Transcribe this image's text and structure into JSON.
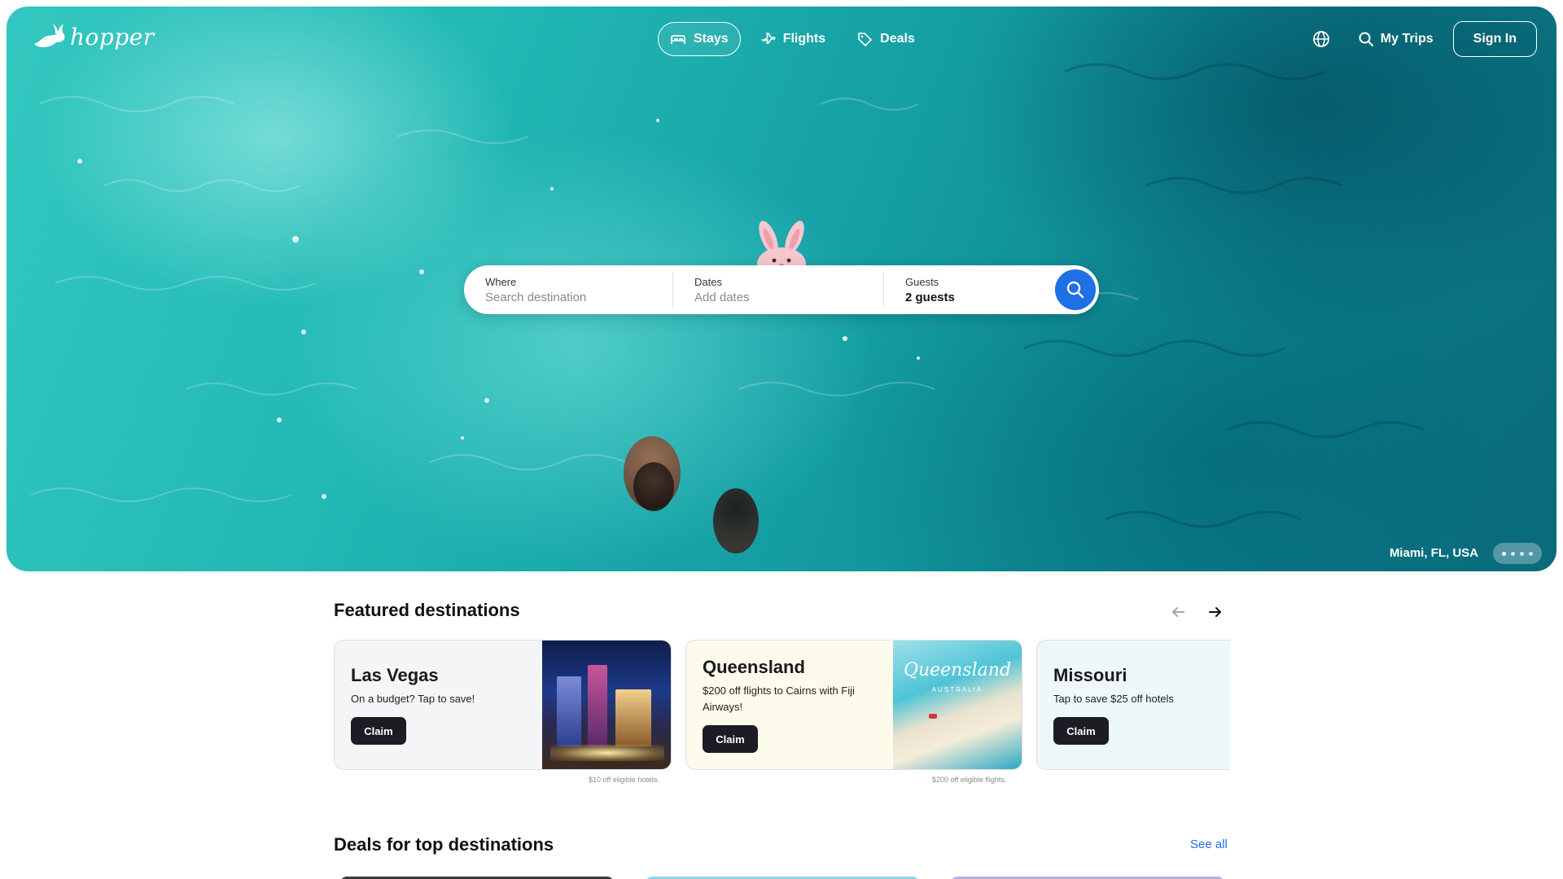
{
  "brand": {
    "name": "hopper"
  },
  "nav": {
    "tabs": [
      {
        "label": "Stays",
        "icon": "bed-icon",
        "active": true
      },
      {
        "label": "Flights",
        "icon": "plane-icon",
        "active": false
      },
      {
        "label": "Deals",
        "icon": "tag-icon",
        "active": false
      }
    ],
    "language_icon": "globe-icon",
    "my_trips": "My Trips",
    "sign_in": "Sign In"
  },
  "search": {
    "where_label": "Where",
    "where_placeholder": "Search destination",
    "dates_label": "Dates",
    "dates_placeholder": "Add dates",
    "guests_label": "Guests",
    "guests_value": "2 guests",
    "button_icon": "search-icon"
  },
  "hero": {
    "location": "Miami, FL, USA",
    "slide_dots": 4,
    "active_dot": 0
  },
  "featured": {
    "title": "Featured destinations",
    "cards": [
      {
        "title": "Las Vegas",
        "desc": "On a budget? Tap to save!",
        "cta": "Claim",
        "footnote": "$10 off eligible hotels.",
        "bg": "#f4f5f7"
      },
      {
        "title": "Queensland",
        "desc": "$200 off flights to Cairns with Fiji Airways!",
        "cta": "Claim",
        "footnote": "$200 off eligible flights.",
        "bg": "#fdfbec",
        "image_text": "Queensland",
        "image_subtext": "AUSTRALIA"
      },
      {
        "title": "Missouri",
        "desc": "Tap to save $25 off hotels",
        "cta": "Claim",
        "bg": "#eef7fa"
      }
    ]
  },
  "deals": {
    "title": "Deals for top destinations",
    "see_all": "See all"
  },
  "colors": {
    "accent": "#1f6fe5",
    "claim_button": "#1c1c24"
  }
}
